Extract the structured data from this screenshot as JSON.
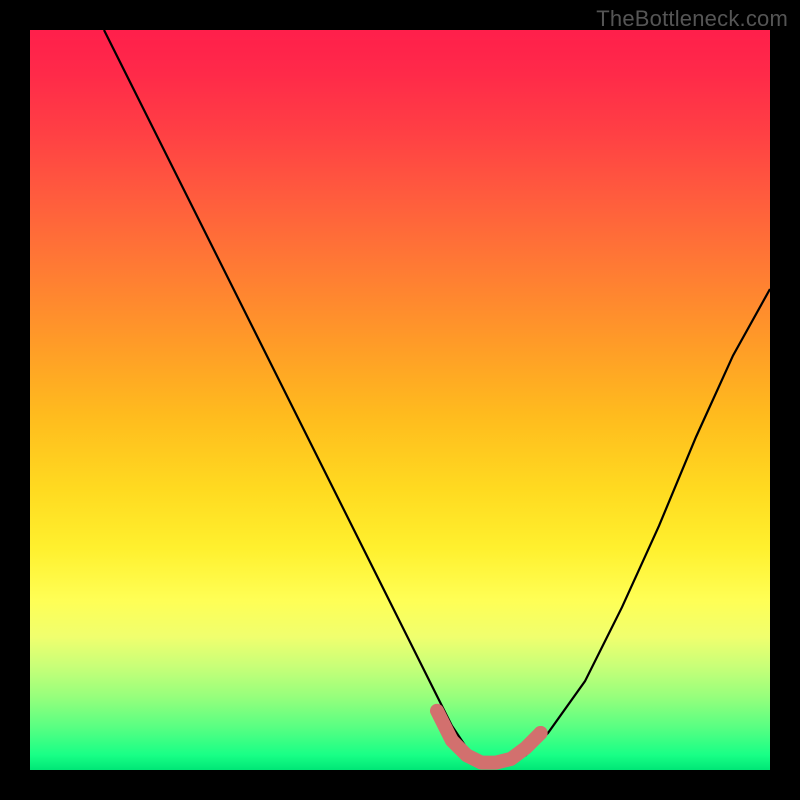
{
  "watermark": "TheBottleneck.com",
  "colors": {
    "frame": "#000000",
    "gradient_top": "#ff1f4b",
    "gradient_mid": "#ffda20",
    "gradient_bottom": "#00e676",
    "curve": "#000000",
    "marker_stroke": "#d2706e",
    "marker_fill": "#d2706e"
  },
  "chart_data": {
    "type": "line",
    "title": "",
    "xlabel": "",
    "ylabel": "",
    "xlim": [
      0,
      100
    ],
    "ylim": [
      0,
      100
    ],
    "x": [
      10,
      15,
      20,
      25,
      30,
      35,
      40,
      45,
      50,
      52.5,
      55,
      57,
      59,
      61,
      63,
      65,
      67,
      70,
      75,
      80,
      85,
      90,
      95,
      100
    ],
    "y": [
      100,
      90,
      80,
      70,
      60,
      50,
      40,
      30,
      20,
      15,
      10,
      6,
      3,
      1,
      1,
      1,
      2,
      5,
      12,
      22,
      33,
      45,
      56,
      65
    ],
    "markers": {
      "x": [
        55,
        57,
        59,
        61,
        63,
        65,
        67,
        69
      ],
      "y": [
        8,
        4,
        2,
        1,
        1,
        1.5,
        3,
        5
      ]
    }
  }
}
